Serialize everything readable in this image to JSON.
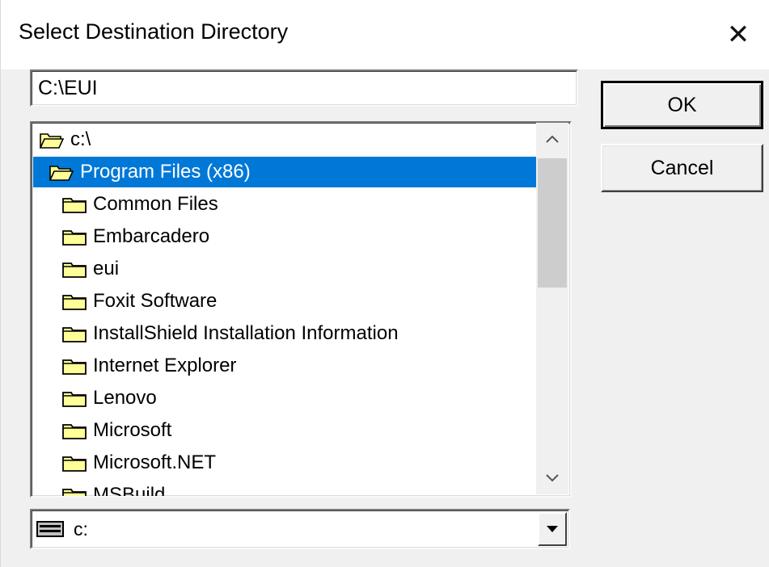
{
  "window": {
    "title": "Select Destination Directory",
    "close_glyph": "✕"
  },
  "path_input": {
    "value": "C:\\EUI"
  },
  "buttons": {
    "ok": "OK",
    "cancel": "Cancel"
  },
  "tree": {
    "items": [
      {
        "label": "c:\\",
        "icon": "open-folder-icon",
        "selected": false
      },
      {
        "label": "Program Files (x86)",
        "icon": "open-folder-icon",
        "selected": true
      },
      {
        "label": "Common Files",
        "icon": "folder-icon",
        "selected": false
      },
      {
        "label": "Embarcadero",
        "icon": "folder-icon",
        "selected": false
      },
      {
        "label": "eui",
        "icon": "folder-icon",
        "selected": false
      },
      {
        "label": "Foxit Software",
        "icon": "folder-icon",
        "selected": false
      },
      {
        "label": "InstallShield Installation Information",
        "icon": "folder-icon",
        "selected": false
      },
      {
        "label": "Internet Explorer",
        "icon": "folder-icon",
        "selected": false
      },
      {
        "label": "Lenovo",
        "icon": "folder-icon",
        "selected": false
      },
      {
        "label": "Microsoft",
        "icon": "folder-icon",
        "selected": false
      },
      {
        "label": "Microsoft.NET",
        "icon": "folder-icon",
        "selected": false
      },
      {
        "label": "MSBuild",
        "icon": "folder-icon",
        "selected": false
      }
    ]
  },
  "drive_select": {
    "value": "c:"
  },
  "colors": {
    "selection": "#0078d7",
    "folder_fill": "#ffff99",
    "window_bg": "#f0f0f0"
  }
}
